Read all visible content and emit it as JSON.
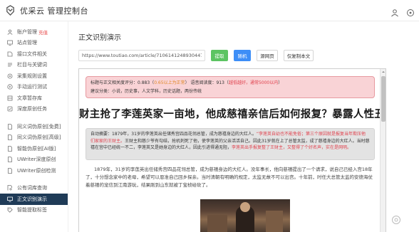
{
  "header": {
    "title": "优采云 管理控制台"
  },
  "sidebar": {
    "items": [
      {
        "label": "账户管理",
        "tag": "充值",
        "icon": "user-icon"
      },
      {
        "label": "站点管理",
        "tag": "",
        "icon": "site-icon"
      },
      {
        "label": "接口文件相关",
        "tag": "",
        "icon": "api-file-icon"
      },
      {
        "label": "栏目与关键词",
        "tag": "",
        "icon": "keyword-icon"
      },
      {
        "label": "采集规则设置",
        "tag": "",
        "icon": "rule-icon"
      },
      {
        "label": "手动运行测试",
        "tag": "",
        "icon": "play-icon"
      },
      {
        "label": "文章暂存库",
        "tag": "",
        "icon": "storage-icon"
      },
      {
        "label": "深度原创任务",
        "tag": "",
        "icon": "task-icon"
      }
    ],
    "items2": [
      {
        "label": "同义词伪原创[免费]",
        "icon": "doc-icon"
      },
      {
        "label": "同义词伪原创[高级]",
        "icon": "doc-icon"
      },
      {
        "label": "智能伪原创[AI版]",
        "icon": "doc-icon"
      },
      {
        "label": "UWriter深度原创",
        "icon": "doc-icon"
      },
      {
        "label": "UWriter原创检测",
        "icon": "doc-icon"
      }
    ],
    "items3": [
      {
        "label": "公有词库查询",
        "icon": "search-doc-icon"
      },
      {
        "label": "正文识别演示",
        "icon": "screen-icon",
        "active": true
      },
      {
        "label": "智能提取标签",
        "icon": "tag-icon"
      }
    ]
  },
  "main": {
    "page_title": "正文识别演示",
    "url_value": "https://www.toutiao.com/article/7106141248930447",
    "buttons": {
      "extract": "提取",
      "random": "随机",
      "source": "源网页",
      "copy_text": "仅复制本文"
    },
    "stats": {
      "line1_prefix": "标题与正文相关度评分：0.883（",
      "line1_score_note": "0.65以上为正常",
      "line1_mid": "）  语音阅读度：913（",
      "line1_read_note": "越低越好，通常5000以内",
      "line1_suffix": "）",
      "line2": "建议分类：小说，历史事，人文学科，历史话题，两份传统"
    },
    "headline": "财主抢了李莲英家一亩地，他成慈禧亲信后如何报复？暴露人性丑恶",
    "summary": {
      "label": "自动摘要：",
      "text": "1879年，31岁的李莲英出任储秀宫四品花翎总管，成为慈禧身边的大红人。",
      "highlight": "“李莲英自幼也不能免俗；第三个原因就是报复当年欺压他们家家的王财主。",
      "text2": "王财主和慈少爷有勾结，抢机刺死了他，使李莲英的父亲活活自己。因此31岁就在上了总管太监，成了慈禧身边的大红人。当时慈禧在宫中已经统一不二，李莲英又是她身边的大红人，因此引进得通无阻，",
      "highlight2": "李莲英出手报复整了王财主，又整得了个好名声，实在是网明。"
    },
    "body": {
      "text": "1879年，31岁的李莲英出任储秀宫四品花翎总管，成为慈禧身边的大红人。没年事长，他向慈禧提出了一个请求，说自己已经入宫18年了，十分想念家中的老母，希望可以恩准自己回乡探亲。当时清朝有明确的规定，太监无故不可以出宫。十年前，时任大总管太监的安德海仗着慈禧的宠信到江南游玩，结果刚到山东就被丁宝桢给砍了。"
    }
  },
  "colors": {
    "accent_green": "#5cc462",
    "accent_blue": "#3d8ef7",
    "active_nav": "#1f3b57",
    "alert_red": "#e0414d"
  }
}
